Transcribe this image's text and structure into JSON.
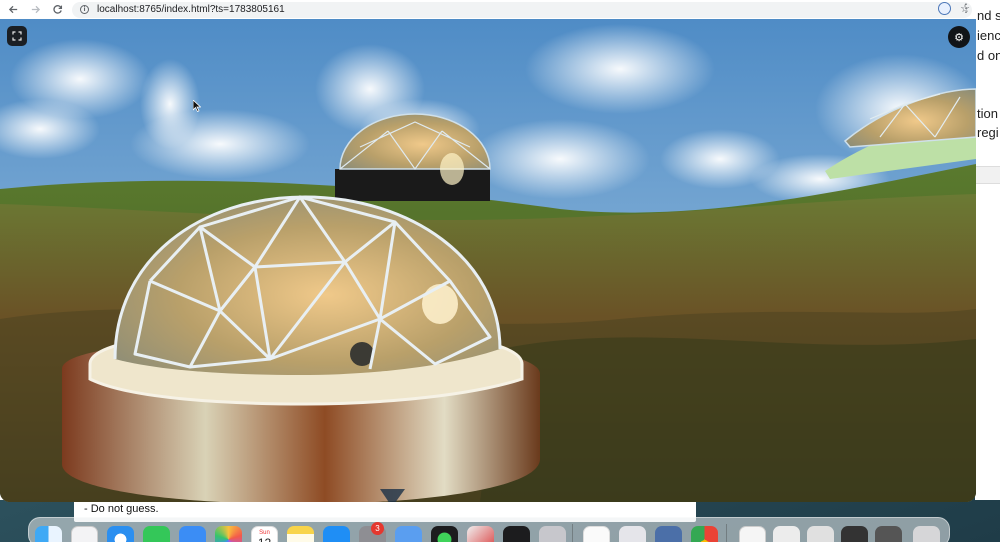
{
  "browser": {
    "url": "localhost:8765/index.html?ts=1783805161"
  },
  "background_document": {
    "lines": [
      "nd sc",
      "ience",
      "d on t",
      "tion",
      "regi"
    ]
  },
  "background_panel": {
    "text": "- Do not guess."
  },
  "viewport": {
    "fullscreen_icon": "fullscreen-icon",
    "settings_icon": "gear-icon"
  },
  "dock": {
    "calendar": {
      "month": "Sun",
      "day": "12"
    },
    "system_settings_badge": "3",
    "apps": [
      "finder",
      "launchpad",
      "safari",
      "messages",
      "mail",
      "photos",
      "calendar",
      "notes",
      "app-store",
      "system-settings",
      "preview",
      "activity-monitor",
      "app",
      "terminal",
      "phone",
      "textedit",
      "scripts",
      "disk-utility",
      "chrome"
    ]
  },
  "colors": {
    "sky": "#5d95c8",
    "grass": "#6b5a2a",
    "chrome_bg": "#ffffff",
    "accent": "#4c77b8"
  }
}
